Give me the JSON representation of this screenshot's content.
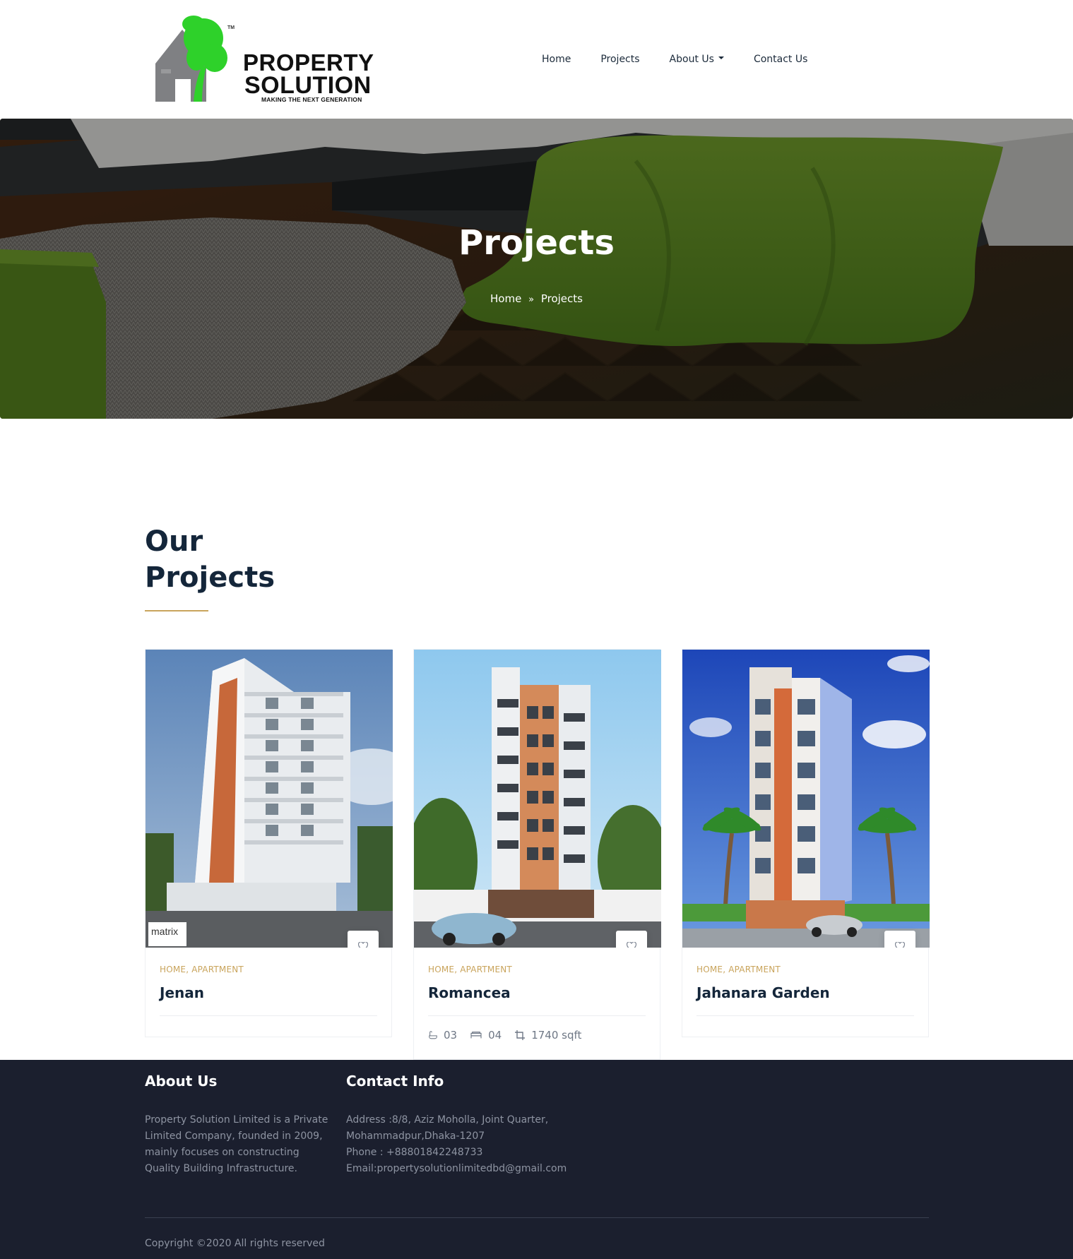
{
  "brand": {
    "name_line1": "PROPERTY",
    "name_line2": "SOLUTION",
    "tagline": "MAKING THE NEXT GENERATION",
    "tm": "TM",
    "colors": {
      "green": "#2ed12a",
      "grey": "#7f8083",
      "gold": "#c9a45c",
      "navy": "#14263a",
      "footer": "#1b1f2e"
    }
  },
  "nav": {
    "items": [
      {
        "label": "Home"
      },
      {
        "label": "Projects"
      },
      {
        "label": "About Us",
        "dropdown": true
      },
      {
        "label": "Contact Us"
      }
    ]
  },
  "hero": {
    "title": "Projects",
    "breadcrumb": {
      "home": "Home",
      "current": "Projects",
      "separator_icon": "double-chevron-right-icon"
    }
  },
  "section": {
    "title_line1": "Our",
    "title_line2": "Projects"
  },
  "projects": [
    {
      "category": "HOME, APARTMENT",
      "name": "Jenan",
      "favorite_icon": "heart-icon"
    },
    {
      "category": "HOME, APARTMENT",
      "name": "Romancea",
      "favorite_icon": "heart-icon",
      "features": {
        "baths": "03",
        "beds": "04",
        "area": "1740 sqft"
      }
    },
    {
      "category": "HOME, APARTMENT",
      "name": "Jahanara Garden",
      "favorite_icon": "heart-icon"
    }
  ],
  "footer": {
    "about": {
      "heading": "About Us",
      "text": "Property Solution Limited is a Private Limited Company, founded in 2009, mainly focuses on constructing Quality Building Infrastructure."
    },
    "contact": {
      "heading": "Contact Info",
      "address": "Address :8/8, Aziz Moholla, Joint Quarter, Mohammadpur,Dhaka-1207",
      "phone": "Phone : +88801842248733",
      "email": "Email:propertysolutionlimitedbd@gmail.com"
    },
    "copyright": "Copyright ©2020 All rights reserved"
  }
}
